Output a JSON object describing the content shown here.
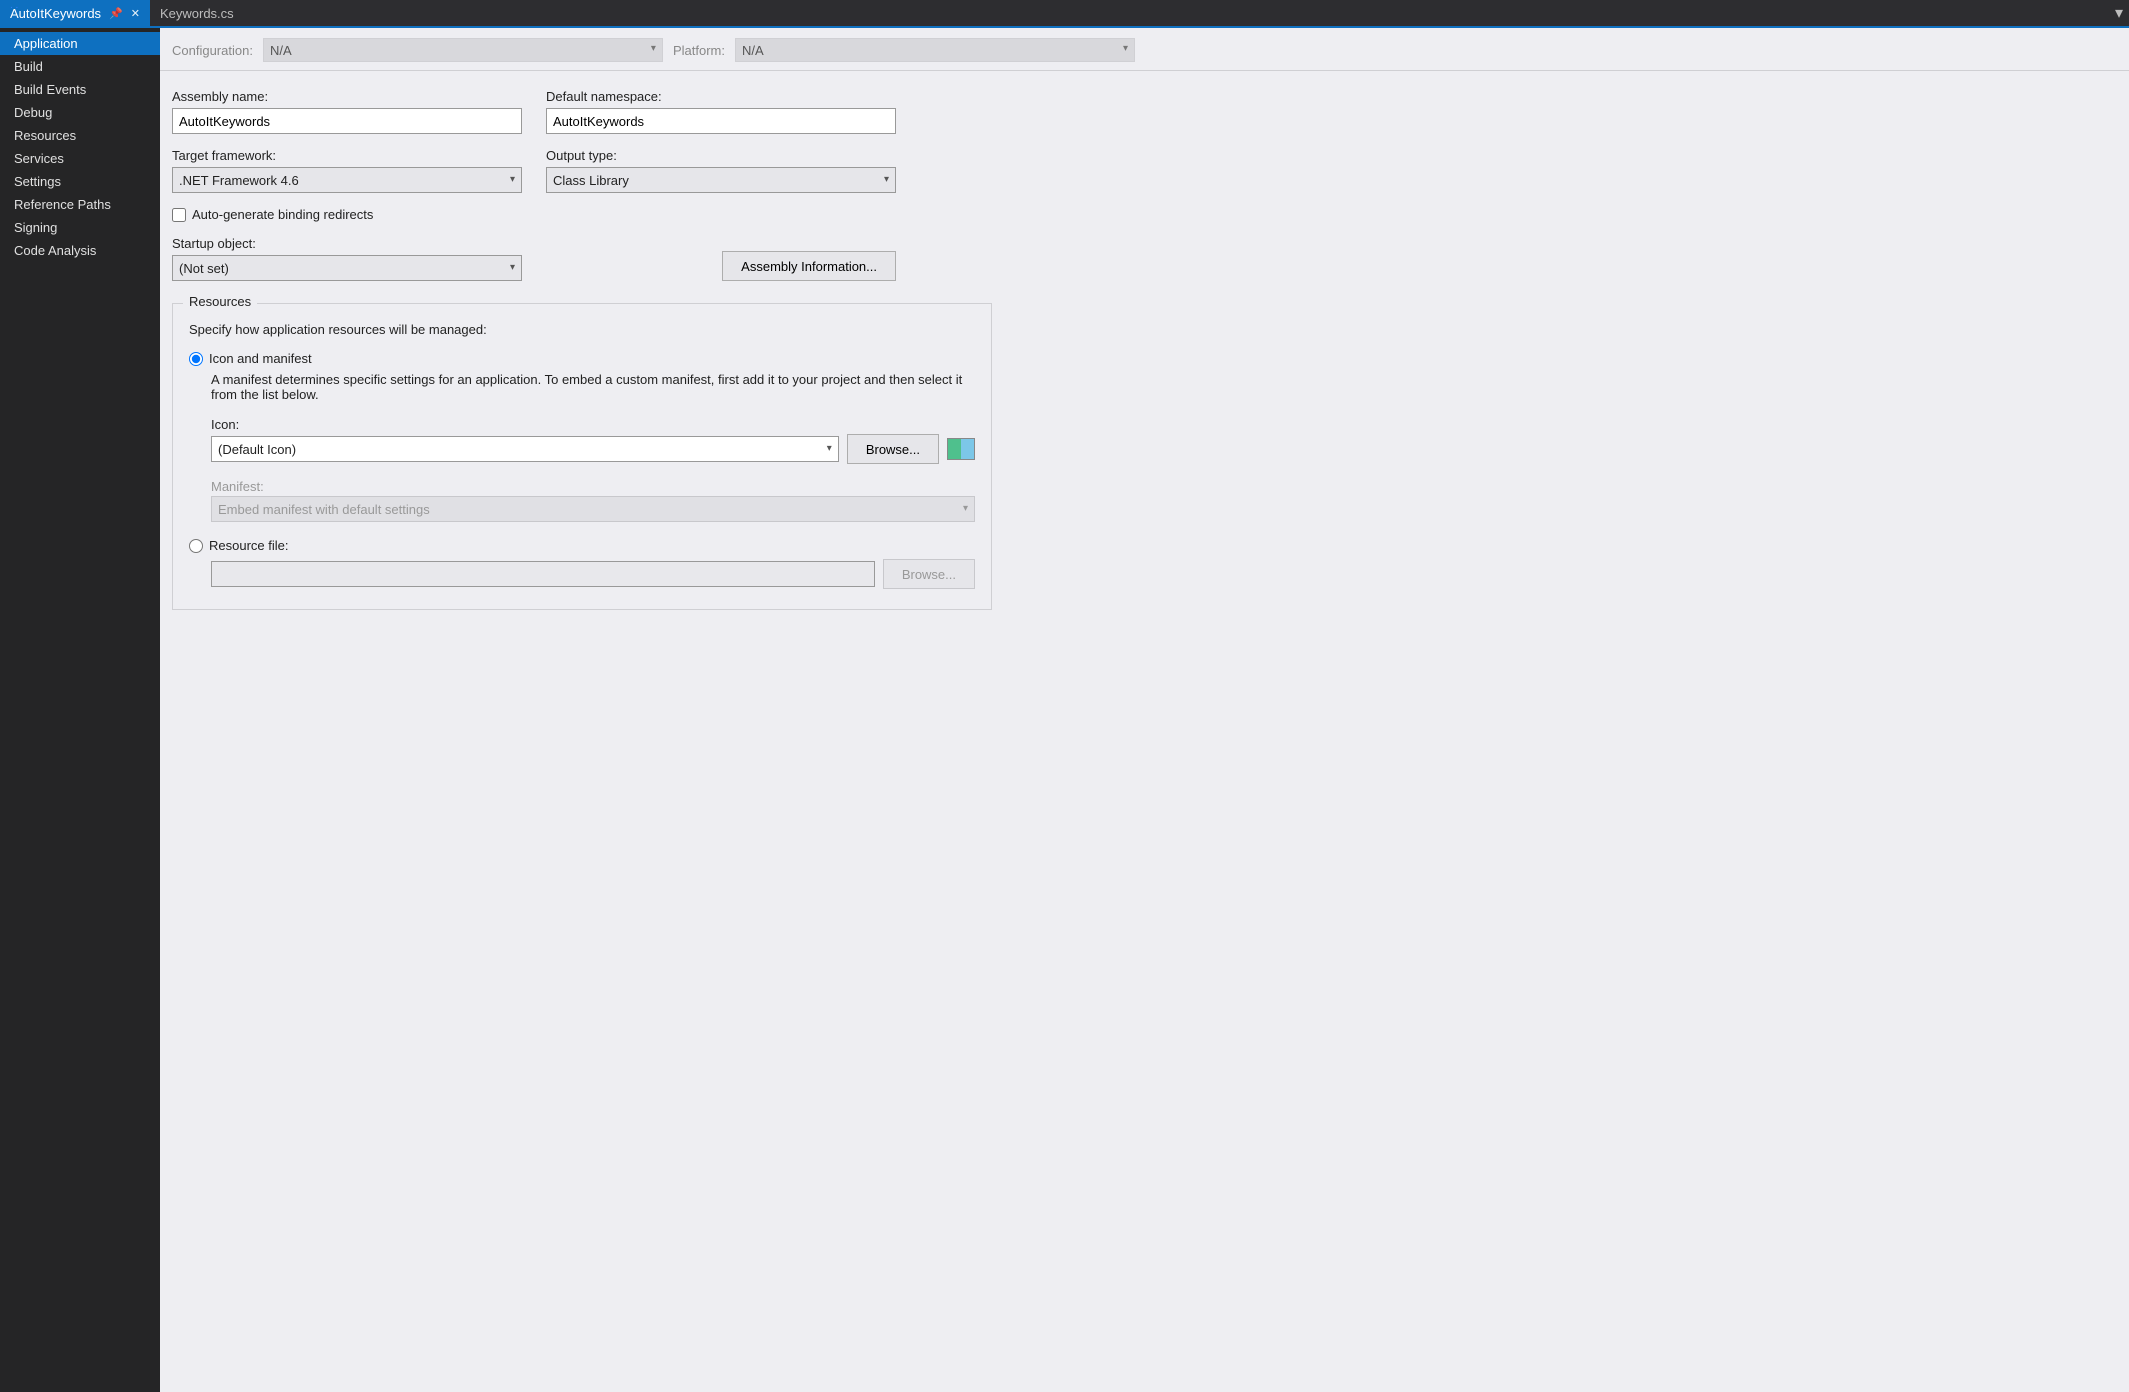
{
  "tabs": {
    "active": {
      "label": "AutoItKeywords"
    },
    "inactive": {
      "label": "Keywords.cs"
    }
  },
  "sidebar": {
    "items": [
      "Application",
      "Build",
      "Build Events",
      "Debug",
      "Resources",
      "Services",
      "Settings",
      "Reference Paths",
      "Signing",
      "Code Analysis"
    ],
    "selected_index": 0
  },
  "cfg": {
    "configuration_label": "Configuration:",
    "configuration_value": "N/A",
    "platform_label": "Platform:",
    "platform_value": "N/A"
  },
  "form": {
    "assembly_name_label": "Assembly name:",
    "assembly_name_value": "AutoItKeywords",
    "default_namespace_label": "Default namespace:",
    "default_namespace_value": "AutoItKeywords",
    "target_framework_label": "Target framework:",
    "target_framework_value": ".NET Framework 4.6",
    "output_type_label": "Output type:",
    "output_type_value": "Class Library",
    "auto_redirect_label": "Auto-generate binding redirects",
    "startup_object_label": "Startup object:",
    "startup_object_value": "(Not set)",
    "assembly_info_btn": "Assembly Information..."
  },
  "resources": {
    "group_title": "Resources",
    "intro": "Specify how application resources will be managed:",
    "opt_icon_manifest": "Icon and manifest",
    "manifest_desc": "A manifest determines specific settings for an application. To embed a custom manifest, first add it to your project and then select it from the list below.",
    "icon_label": "Icon:",
    "icon_value": "(Default Icon)",
    "browse_btn": "Browse...",
    "manifest_label": "Manifest:",
    "manifest_value": "Embed manifest with default settings",
    "opt_resource_file": "Resource file:"
  },
  "misc": {
    "anchor": ". ."
  }
}
